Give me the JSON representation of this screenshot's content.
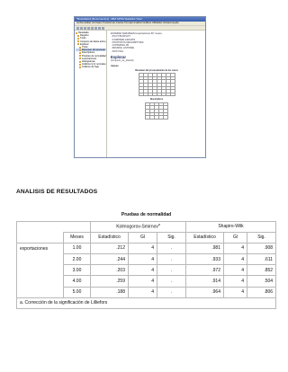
{
  "screenshot": {
    "title": "*Resultado1 [Documento1] - IBM SPSS Statistics Visor",
    "menu": "Archivo  Editar  Ver  Datos  Transformar  Insertar  Formato  Analizar  Gráficos  Utilidades  Ventana  Ayuda",
    "tree": [
      {
        "label": "Resultado",
        "sel": false
      },
      {
        "label": "Registro",
        "sel": false
      },
      {
        "label": "Título",
        "sel": false
      },
      {
        "label": "Conjunto de datos activo",
        "sel": false
      },
      {
        "label": "Explorar",
        "sel": false
      },
      {
        "label": "Título",
        "sel": false
      },
      {
        "label": "Resumen del procesamiento",
        "sel": true
      },
      {
        "label": "Descriptivos",
        "sel": false
      },
      {
        "label": "Pruebas de normalidad",
        "sel": false
      },
      {
        "label": "exportaciones",
        "sel": false
      },
      {
        "label": "Histogramas",
        "sel": false
      },
      {
        "label": "Gráficos Q-Q normales",
        "sel": false
      },
      {
        "label": "Gráficos de caja",
        "sel": false
      }
    ],
    "syntax": "EXAMINE VARIABLES=exportaciones BY meses\n  /PLOT BOXPLOT\n  /COMPARE GROUPS\n  /STATISTICS DESCRIPTIVES\n  /CINTERVAL 95\n  /MISSING LISTWISE\n  /NOTOTAL.",
    "section_title": "Explorar",
    "dataset_label": "[Conjunto_de_datos0]",
    "factor_label": "meses",
    "summary_caption": "Resumen del procesamiento de los casos",
    "desc_caption": "Descriptivos"
  },
  "heading": "ANALISIS DE RESULTADOS",
  "table": {
    "caption": "Pruebas de normalidad",
    "group_ks": "Kolmogorov-Smirnov",
    "group_ks_sup": "a",
    "group_sw": "Shapiro-Wilk",
    "col_factor": "Meses",
    "col_stat": "Estadístico",
    "col_df": "Gl",
    "col_sig": "Sig.",
    "variable": "exportaciones",
    "rows": [
      {
        "mes": "1.00",
        "ks_stat": ".212",
        "ks_gl": "4",
        "ks_sig": ".",
        "sw_stat": ".981",
        "sw_gl": "4",
        "sw_sig": ".908"
      },
      {
        "mes": "2.00",
        "ks_stat": ".244",
        "ks_gl": "4",
        "ks_sig": ".",
        "sw_stat": ".933",
        "sw_gl": "4",
        "sw_sig": ".611"
      },
      {
        "mes": "3.00",
        "ks_stat": ".203",
        "ks_gl": "4",
        "ks_sig": ".",
        "sw_stat": ".972",
        "sw_gl": "4",
        "sw_sig": ".852"
      },
      {
        "mes": "4.00",
        "ks_stat": ".259",
        "ks_gl": "4",
        "ks_sig": ".",
        "sw_stat": ".914",
        "sw_gl": "4",
        "sw_sig": ".504"
      },
      {
        "mes": "5.00",
        "ks_stat": ".188",
        "ks_gl": "4",
        "ks_sig": ".",
        "sw_stat": ".964",
        "sw_gl": "4",
        "sw_sig": ".806"
      }
    ],
    "footnote": "a. Corrección de la significación de Lilliefors"
  }
}
